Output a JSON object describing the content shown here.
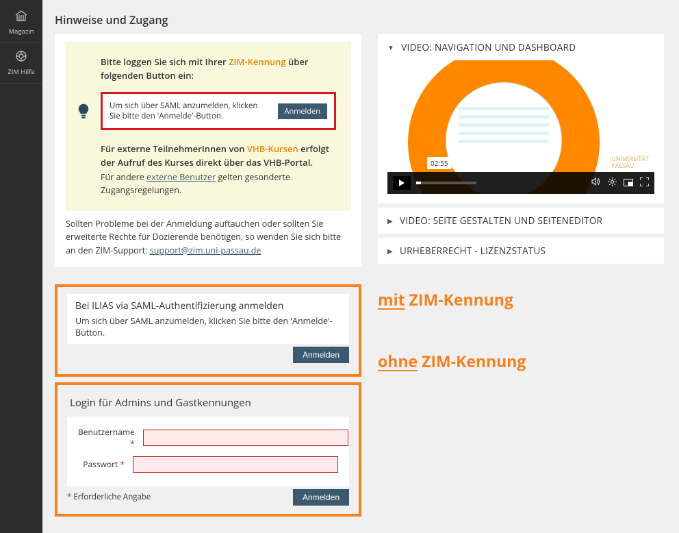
{
  "sidebar": {
    "items": [
      {
        "label": "Magazin",
        "icon": "magazin-icon"
      },
      {
        "label": "ZIM Hilfe",
        "icon": "help-icon"
      }
    ]
  },
  "page_title": "Hinweise und Zugang",
  "info_box": {
    "line1_pre": "Bitte loggen Sie sich mit Ihrer ",
    "zim": "ZIM-Kennung",
    "line1_post": " über folgenden Button ein:",
    "saml_hint": "Um sich über SAML anzumelden, klicken Sie bitte den 'Anmelde'-Button.",
    "saml_btn": "Anmelden",
    "ext_pre": "Für externe TeilnehmerInnen von ",
    "vhb": "VHB-Kursen",
    "ext_post": " erfolgt der Aufruf des Kurses direkt über das VHB-Portal.",
    "other_pre": "Für andere ",
    "other_link": "externe Benutzer",
    "other_post": " gelten gesonderte Zugangsregelungen."
  },
  "below_box": {
    "text": "Sollten Probleme bei der Anmeldung auftauchen oder sollten Sie erweiterte Rechte für Dozierende benötigen, so wenden Sie sich bitte an den ZIM-Support: ",
    "email": "support@zim.uni-passau.de"
  },
  "saml_card": {
    "title": "Bei ILIAS via SAML-Authentifizierung anmelden",
    "text": "Um sich über SAML anzumelden, klicken Sie bitte den 'Anmelde'-Button.",
    "btn": "Anmelden"
  },
  "admin_card": {
    "title": "Login für Admins und Gastkennungen",
    "user_label": "Benutzername",
    "pass_label": "Passwort",
    "required_marker": "*",
    "required_text": "Erforderliche Angabe",
    "btn": "Anmelden"
  },
  "accordions": [
    {
      "label": "VIDEO: NAVIGATION UND DASHBOARD",
      "expanded": true
    },
    {
      "label": "VIDEO: SEITE GESTALTEN UND SEITENEDITOR",
      "expanded": false
    },
    {
      "label": "URHEBERRECHT - LIZENZSTATUS",
      "expanded": false
    }
  ],
  "video": {
    "time": "02:55",
    "logo_line1": "UNIVERSITÄT",
    "logo_line2": "PASSAU"
  },
  "annotations": {
    "mit": "mit",
    "mit_rest": " ZIM-Kennung",
    "ohne": "ohne",
    "ohne_rest": " ZIM-Kennung"
  }
}
